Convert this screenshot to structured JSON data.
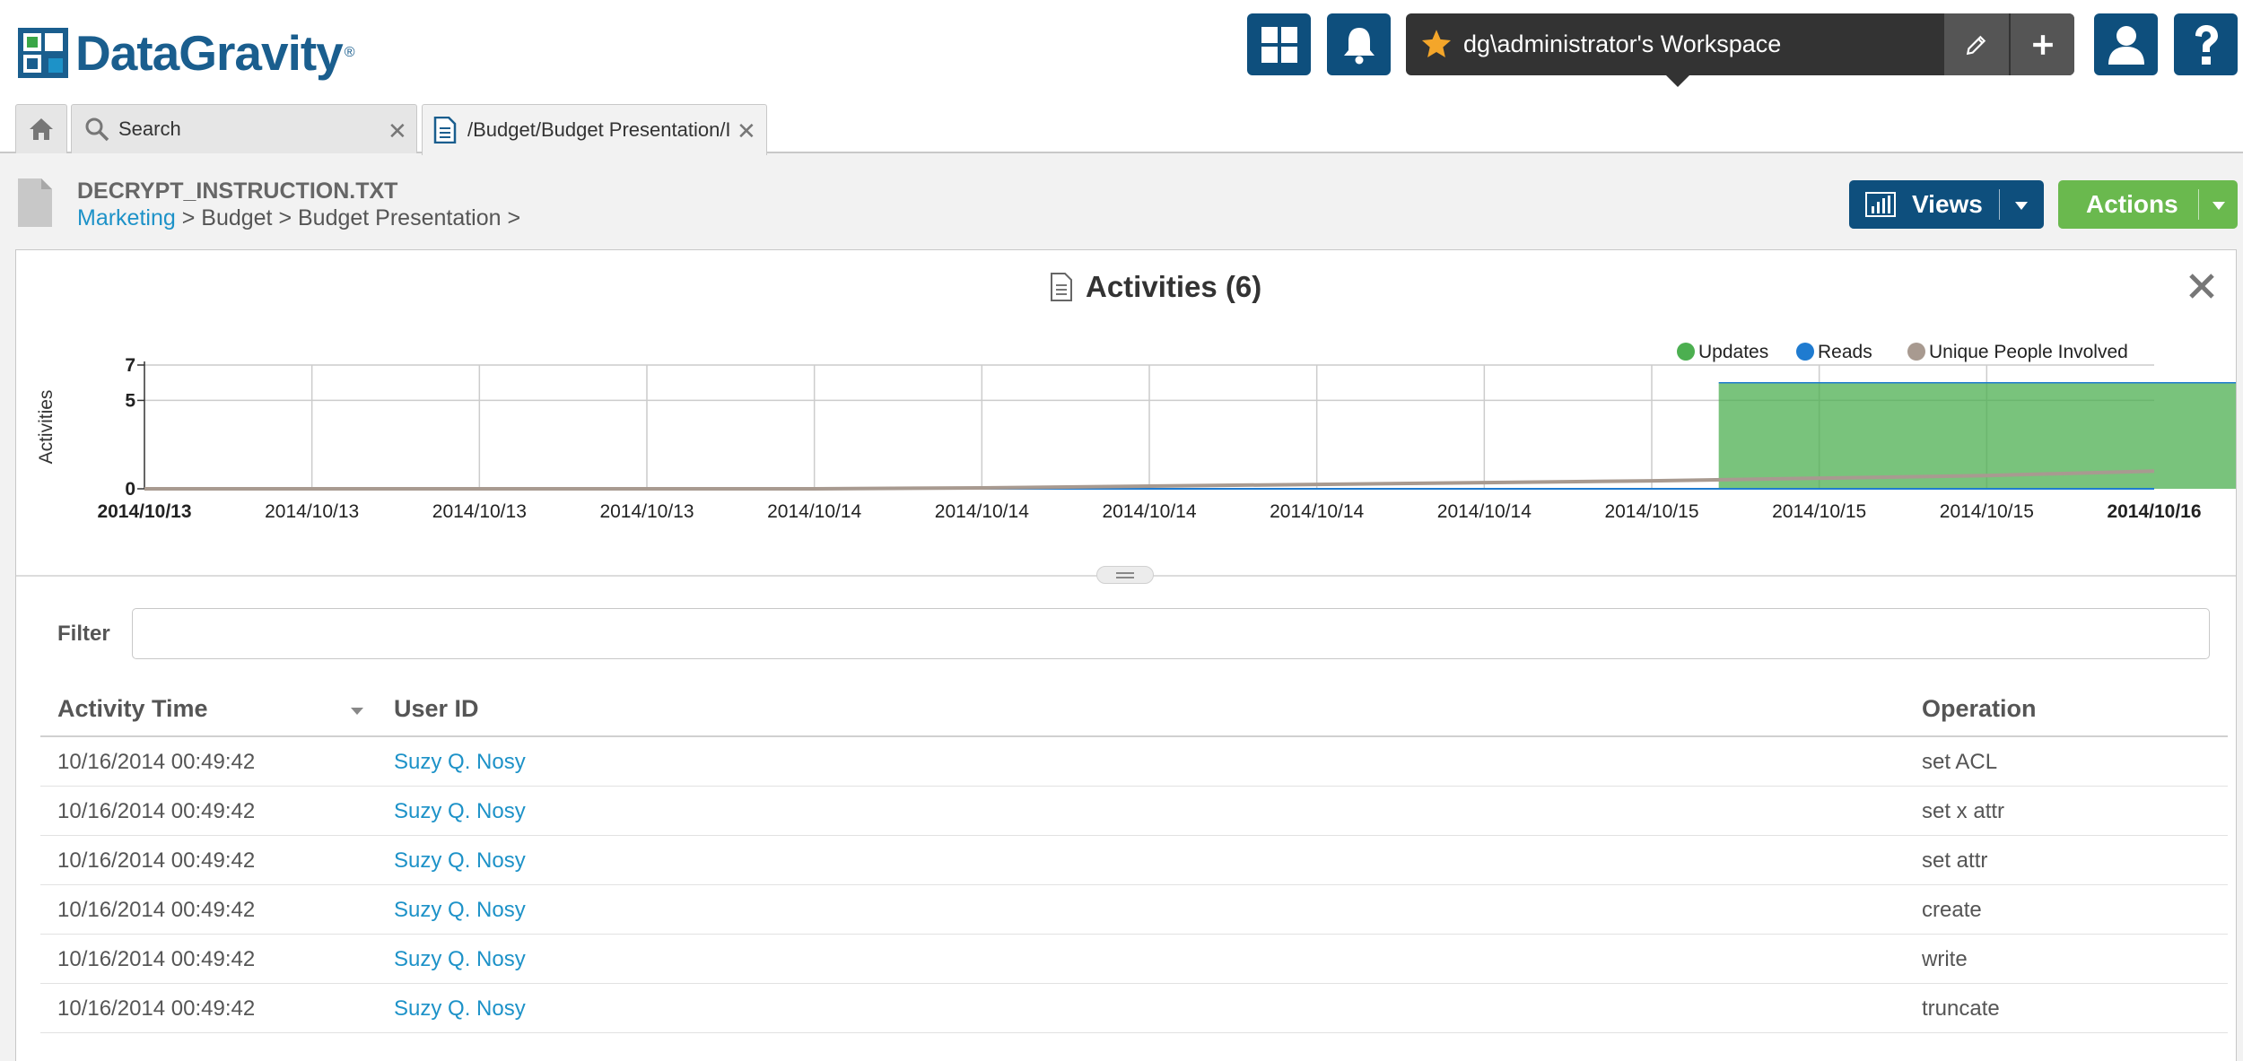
{
  "app": {
    "logo_text": "DataGravity",
    "logo_tm": "®"
  },
  "header": {
    "dashboard_icon": "grid-icon",
    "notifications_icon": "bell-icon",
    "workspace_label": "dg\\administrator's Workspace",
    "user_icon": "user-icon",
    "help_icon": "question-icon"
  },
  "tabs": [
    {
      "icon": "home-icon",
      "label": ""
    },
    {
      "icon": "search-icon",
      "label": "Search"
    },
    {
      "icon": "document-icon",
      "label": "/Budget/Budget Presentation/I"
    }
  ],
  "file": {
    "name": "DECRYPT_INSTRUCTION.TXT",
    "breadcrumb_link": "Marketing",
    "breadcrumb_rest": "> Budget > Budget Presentation >"
  },
  "buttons": {
    "views": "Views",
    "actions": "Actions"
  },
  "colors": {
    "brand": "#0e4f7d",
    "updates": "#4caf50",
    "reads": "#1f7bd0",
    "unique_people": "#a89a90",
    "link": "#1d92c8",
    "actions": "#6ab94e"
  },
  "panel": {
    "title": "Activities (6)"
  },
  "chart_data": {
    "type": "area",
    "title": "Activities (6)",
    "ylabel": "Activities",
    "xlabel": "",
    "ylim": [
      0,
      7
    ],
    "yticks": [
      0,
      5,
      7
    ],
    "x_labels": [
      "2014/10/13",
      "2014/10/13",
      "2014/10/13",
      "2014/10/13",
      "2014/10/14",
      "2014/10/14",
      "2014/10/14",
      "2014/10/14",
      "2014/10/14",
      "2014/10/15",
      "2014/10/15",
      "2014/10/15",
      "2014/10/16"
    ],
    "x_labels_bold": [
      true,
      false,
      false,
      false,
      false,
      false,
      false,
      false,
      false,
      false,
      false,
      false,
      true
    ],
    "legend_position": "top-right",
    "grid": true,
    "series": [
      {
        "name": "Updates",
        "color": "#4caf50",
        "kind": "area",
        "x_start_index": 9.4,
        "x_end_index": 12.75,
        "value": 6
      },
      {
        "name": "Reads",
        "color": "#1f7bd0",
        "kind": "line",
        "values": [
          0,
          0,
          0,
          0,
          0,
          0,
          0,
          0,
          0,
          0,
          0,
          0,
          0
        ]
      },
      {
        "name": "Unique People Involved",
        "color": "#a89a90",
        "kind": "line",
        "values": [
          0,
          0,
          0,
          0,
          0,
          0.05,
          0.15,
          0.25,
          0.35,
          0.45,
          0.6,
          0.75,
          1.0
        ]
      }
    ]
  },
  "filter": {
    "label": "Filter",
    "value": "",
    "placeholder": ""
  },
  "table": {
    "columns": [
      "Activity Time",
      "User ID",
      "Operation"
    ],
    "rows": [
      {
        "time": "10/16/2014 00:49:42",
        "user": "Suzy Q. Nosy",
        "operation": "set ACL"
      },
      {
        "time": "10/16/2014 00:49:42",
        "user": "Suzy Q. Nosy",
        "operation": "set x attr"
      },
      {
        "time": "10/16/2014 00:49:42",
        "user": "Suzy Q. Nosy",
        "operation": "set attr"
      },
      {
        "time": "10/16/2014 00:49:42",
        "user": "Suzy Q. Nosy",
        "operation": "create"
      },
      {
        "time": "10/16/2014 00:49:42",
        "user": "Suzy Q. Nosy",
        "operation": "write"
      },
      {
        "time": "10/16/2014 00:49:42",
        "user": "Suzy Q. Nosy",
        "operation": "truncate"
      }
    ]
  }
}
